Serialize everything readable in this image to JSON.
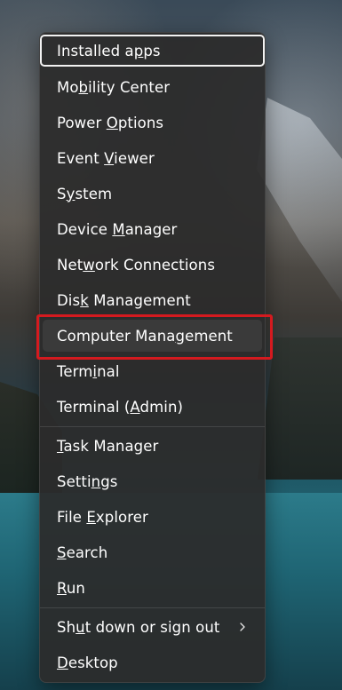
{
  "menu": {
    "items": [
      {
        "label": "Installed apps",
        "mnemonic": "p"
      },
      {
        "label": "Mobility Center",
        "mnemonic": "b"
      },
      {
        "label": "Power Options",
        "mnemonic": "O"
      },
      {
        "label": "Event Viewer",
        "mnemonic": "V"
      },
      {
        "label": "System",
        "mnemonic": "y"
      },
      {
        "label": "Device Manager",
        "mnemonic": "M"
      },
      {
        "label": "Network Connections",
        "mnemonic": "w"
      },
      {
        "label": "Disk Management",
        "mnemonic": "k"
      },
      {
        "label": "Computer Management",
        "mnemonic": "g"
      },
      {
        "label": "Terminal",
        "mnemonic": "i"
      },
      {
        "label": "Terminal (Admin)",
        "mnemonic": "A"
      },
      {
        "label": "Task Manager",
        "mnemonic": "T"
      },
      {
        "label": "Settings",
        "mnemonic": "n"
      },
      {
        "label": "File Explorer",
        "mnemonic": "E"
      },
      {
        "label": "Search",
        "mnemonic": "S"
      },
      {
        "label": "Run",
        "mnemonic": "R"
      },
      {
        "label": "Shut down or sign out",
        "mnemonic": "u",
        "submenu": true
      },
      {
        "label": "Desktop",
        "mnemonic": "D"
      }
    ]
  },
  "icons": {
    "submenu": "chevron-right-icon"
  },
  "colors": {
    "menu_background": "#2c2c2c",
    "text": "#ffffff",
    "focus_border": "#f2f2f2",
    "annotation_highlight": "#d41a1f"
  }
}
